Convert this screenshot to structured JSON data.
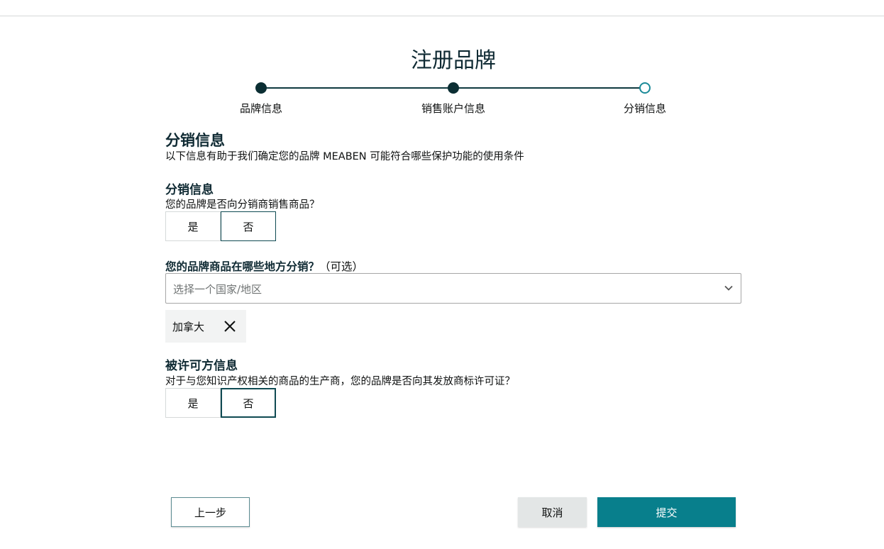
{
  "page": {
    "title": "注册品牌"
  },
  "stepper": {
    "steps": [
      {
        "label": "品牌信息",
        "state": "completed"
      },
      {
        "label": "销售账户信息",
        "state": "completed"
      },
      {
        "label": "分销信息",
        "state": "current"
      }
    ]
  },
  "section": {
    "title": "分销信息",
    "description": "以下信息有助于我们确定您的品牌 MEABEN 可能符合哪些保护功能的使用条件"
  },
  "distribution": {
    "title": "分销信息",
    "question": "您的品牌是否向分销商销售商品？",
    "options": [
      "是",
      "否"
    ],
    "selected": "否"
  },
  "regions": {
    "question": "您的品牌商品在哪些地方分销？",
    "optional_tag": "（可选）",
    "placeholder": "选择一个国家/地区",
    "selected_chips": [
      "加拿大"
    ]
  },
  "licensor": {
    "title": "被许可方信息",
    "question": "对于与您知识产权相关的商品的生产商，您的品牌是否向其发放商标许可证？",
    "options": [
      "是",
      "否"
    ],
    "selected": "否"
  },
  "footer": {
    "prev_label": "上一步",
    "cancel_label": "取消",
    "submit_label": "提交"
  },
  "colors": {
    "accent": "#087f8c",
    "step_dark": "#0b2e33",
    "step_current_ring": "#1b8a98"
  }
}
